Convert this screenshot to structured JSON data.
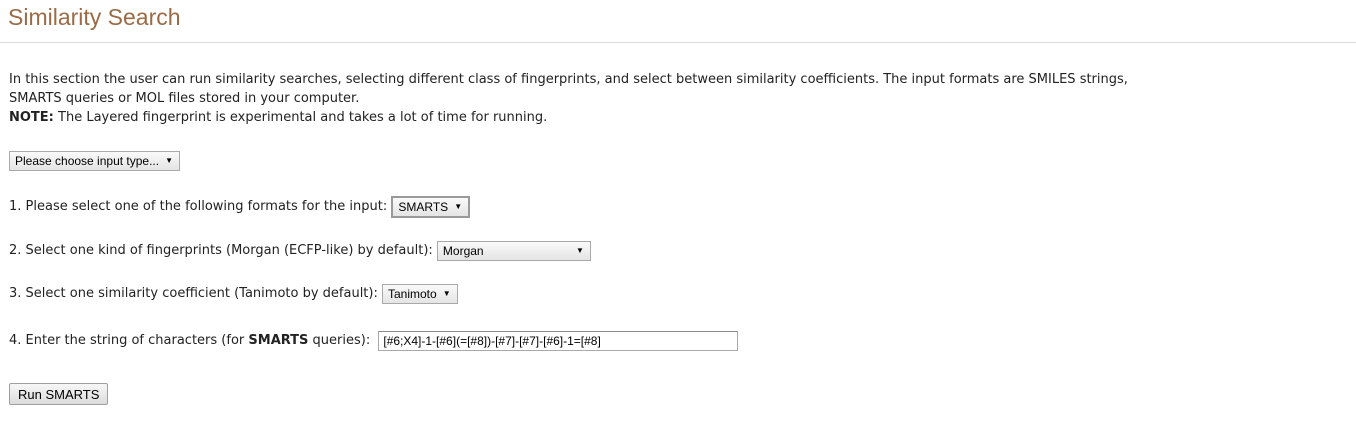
{
  "page": {
    "title": "Similarity Search"
  },
  "intro": {
    "line1": "In this section the user can run similarity searches, selecting different class of fingerprints, and select between similarity coefficients. The input formats are SMILES strings,",
    "line2": "SMARTS queries or MOL files stored in your computer.",
    "note_label": "NOTE:",
    "note_text": " The Layered fingerprint is experimental and takes a lot of time for running."
  },
  "input_type_select": {
    "value": "Please choose input type...",
    "arrow": "▼"
  },
  "step1": {
    "label": "1. Please select one of the following formats for the input: ",
    "select_value": "SMARTS",
    "arrow": "▼"
  },
  "step2": {
    "label": "2. Select one kind of fingerprints (Morgan (ECFP-like) by default): ",
    "select_value": "Morgan",
    "arrow": "▼"
  },
  "step3": {
    "label": "3. Select one similarity coefficient (Tanimoto by default): ",
    "select_value": "Tanimoto",
    "arrow": "▼"
  },
  "step4": {
    "label_before": "4. Enter the string of characters (for ",
    "label_bold": "SMARTS",
    "label_after": " queries): ",
    "input_value": "[#6;X4]-1-[#6](=[#8])-[#7]-[#7]-[#6]-1=[#8]"
  },
  "run_button": {
    "label": "Run SMARTS"
  },
  "colors": {
    "title": "#9c6b45",
    "text": "#222222",
    "rule": "#dcdcdc"
  }
}
